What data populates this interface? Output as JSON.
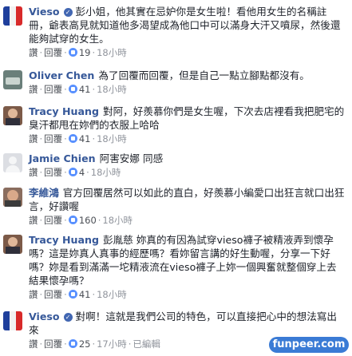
{
  "actions": {
    "like": "讚",
    "reply": "回覆"
  },
  "comments": [
    {
      "author": "Vieso",
      "verified": true,
      "text": "彭小姐，他其實在忌妒你是女生啦！看他用女生的名稱註冊，爺表高見就知道他多渴望成為他口中可以滿身大汗又噴尿，然後還能夠試穿的女生。",
      "likes": "19",
      "time": "18小時"
    },
    {
      "author": "Oliver Chen",
      "text": "為了回覆而回覆，但是自己一點立腳點都沒有。",
      "likes": "41",
      "time": "18小時"
    },
    {
      "author": "Tracy Huang",
      "text": "對阿，好羨慕你們是女生喔，下次去店裡看我把肥宅的臭汗都甩在妳們的衣服上哈哈",
      "likes": "41",
      "time": "18小時"
    },
    {
      "author": "Jamie Chien",
      "text": "阿害安娜 同感",
      "likes": "4",
      "time": "18小時"
    },
    {
      "author": "李維鴻",
      "text": "官方回覆居然可以如此的直白，好羨慕小編愛口出狂言就口出狂言，好讚喔",
      "likes": "160",
      "time": "18小時"
    },
    {
      "author": "Tracy Huang",
      "text": "彭胤慈 妳真的有因為試穿vieso褲子被精液弄到懷孕嗎？這是妳真人真事的經歷嗎？看妳留言講的好生動喔，分享一下好嗎？妳是看到滿滿一坨精液流在vieso褲子上妳一個興奮就整個穿上去結果懷孕嗎？",
      "likes": "41",
      "time": "18小時"
    },
    {
      "author": "Vieso",
      "verified": true,
      "text": "對啊！這就是我們公司的特色，可以直接把心中的想法寫出來",
      "likes": "25",
      "time": "17小時",
      "edited": "已編輯"
    }
  ],
  "watermark": "funpeer.com"
}
